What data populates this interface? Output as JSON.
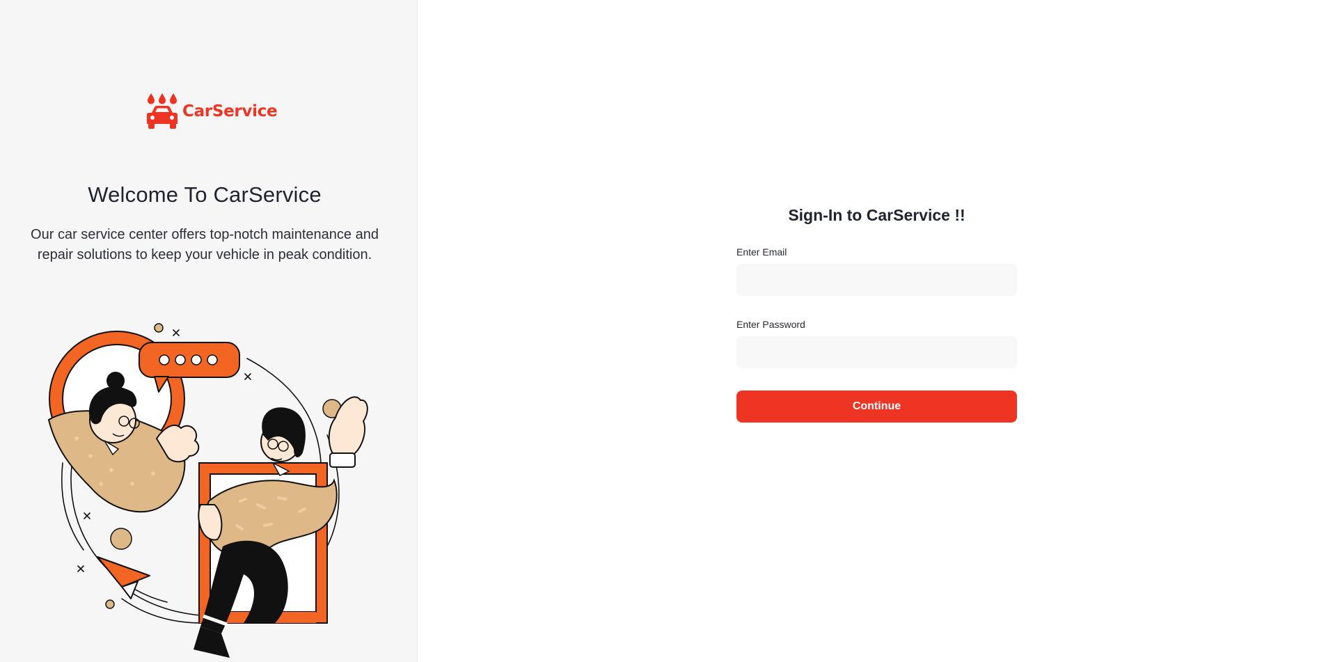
{
  "brand": {
    "name": "CarService",
    "color": "#ee3524",
    "logo_icon": "car-wash-icon"
  },
  "left": {
    "title": "Welcome To CarService",
    "description": "Our car service center offers top-notch maintenance and repair solutions to keep your vehicle in peak condition.",
    "illustration": "customer-support-illustration"
  },
  "form": {
    "title": "Sign-In to CarService !!",
    "email_label": "Enter Email",
    "email_value": "",
    "password_label": "Enter Password",
    "password_value": "",
    "submit_label": "Continue"
  },
  "colors": {
    "accent": "#ee3524",
    "illustration_orange": "#f26522",
    "illustration_tan": "#deb887"
  }
}
